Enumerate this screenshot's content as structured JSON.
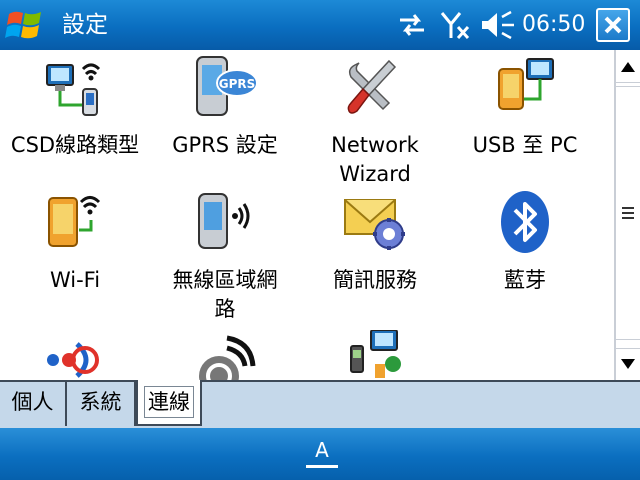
{
  "window": {
    "title": "設定",
    "clock": "06:50",
    "start_icon": "windows-flag-icon",
    "status_icons": [
      "sync-arrows-icon",
      "no-signal-icon",
      "volume-icon"
    ],
    "close_icon": "close-icon"
  },
  "items": [
    {
      "label": "CSD線路類型",
      "icon": "csd-line-icon"
    },
    {
      "label": "GPRS 設定",
      "icon": "gprs-icon"
    },
    {
      "label": "Network\nWizard",
      "icon": "network-wizard-tools-icon"
    },
    {
      "label": "USB 至 PC",
      "icon": "usb-to-pc-icon"
    },
    {
      "label": "Wi-Fi",
      "icon": "wifi-icon"
    },
    {
      "label": "無線區域網\n路",
      "icon": "wireless-lan-icon"
    },
    {
      "label": "簡訊服務",
      "icon": "sms-service-icon"
    },
    {
      "label": "藍芽",
      "icon": "bluetooth-icon"
    },
    {
      "label": "",
      "icon": "beam-icon"
    },
    {
      "label": "",
      "icon": "wireless-sync-icon"
    },
    {
      "label": "",
      "icon": "connections-icon"
    }
  ],
  "tabs": [
    {
      "label": "個人",
      "active": false
    },
    {
      "label": "系統",
      "active": false
    },
    {
      "label": "連線",
      "active": true
    }
  ],
  "softkey": {
    "sip_label": "A",
    "icon": "keyboard-input-icon"
  },
  "colors": {
    "titlebar": "#0a6ec0",
    "tabbar": "#c5d8ea",
    "menubar": "#0b6fc0"
  }
}
